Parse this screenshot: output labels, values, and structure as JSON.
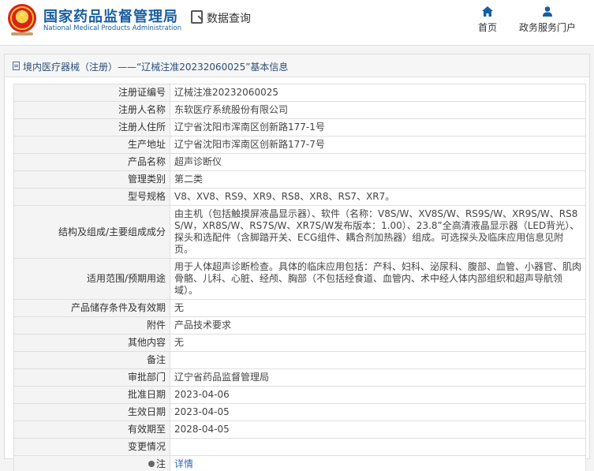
{
  "header": {
    "brand_cn": "国家药品监督管理局",
    "brand_en": "National Medical Products Administration",
    "query_label": "数据查询",
    "nav": [
      {
        "label": "首页",
        "icon": "home-icon"
      },
      {
        "label": "政务服务门户",
        "icon": "user-icon"
      }
    ]
  },
  "page_title": "境内医疗器械（注册）——“辽械注准20232060025”基本信息",
  "rows": [
    {
      "key": "注册证编号",
      "value": "辽械注准20232060025"
    },
    {
      "key": "注册人名称",
      "value": "东软医疗系统股份有限公司"
    },
    {
      "key": "注册人住所",
      "value": "辽宁省沈阳市浑南区创新路177-1号"
    },
    {
      "key": "生产地址",
      "value": "辽宁省沈阳市浑南区创新路177-7号"
    },
    {
      "key": "产品名称",
      "value": "超声诊断仪"
    },
    {
      "key": "管理类别",
      "value": "第二类"
    },
    {
      "key": "型号规格",
      "value": "V8、XV8、RS9、XR9、RS8、XR8、RS7、XR7。"
    },
    {
      "key": "结构及组成/主要组成成分",
      "value": "由主机（包括触摸屏液晶显示器）、软件（名称：V8S/W、XV8S/W、RS9S/W、XR9S/W、RS8S/W，XR8S/W、RS7S/W、XR7S/W发布版本：1.00）、23.8”全高清液晶显示器（LED背光）、探头和选配件（含脚踏开关、ECG组件、耦合剂加热器）组成。可选探头及临床应用信息见附页。"
    },
    {
      "key": "适用范围/预期用途",
      "value": "用于人体超声诊断检查。具体的临床应用包括：产科、妇科、泌尿科、腹部、血管、小器官、肌肉骨骼、儿科、心脏、经颅、胸部（不包括经食道、血管内、术中经人体内部组织和超声导航领域）。"
    },
    {
      "key": "产品储存条件及有效期",
      "value": "无"
    },
    {
      "key": "附件",
      "value": "产品技术要求"
    },
    {
      "key": "其他内容",
      "value": "无"
    },
    {
      "key": "备注",
      "value": ""
    },
    {
      "key": "审批部门",
      "value": "辽宁省药品监督管理局"
    },
    {
      "key": "批准日期",
      "value": "2023-04-06"
    },
    {
      "key": "生效日期",
      "value": "2023-04-05"
    },
    {
      "key": "有效期至",
      "value": "2028-04-05"
    },
    {
      "key": "变更情况",
      "value": ""
    }
  ],
  "note_row": {
    "key": "注",
    "value": "详情"
  }
}
